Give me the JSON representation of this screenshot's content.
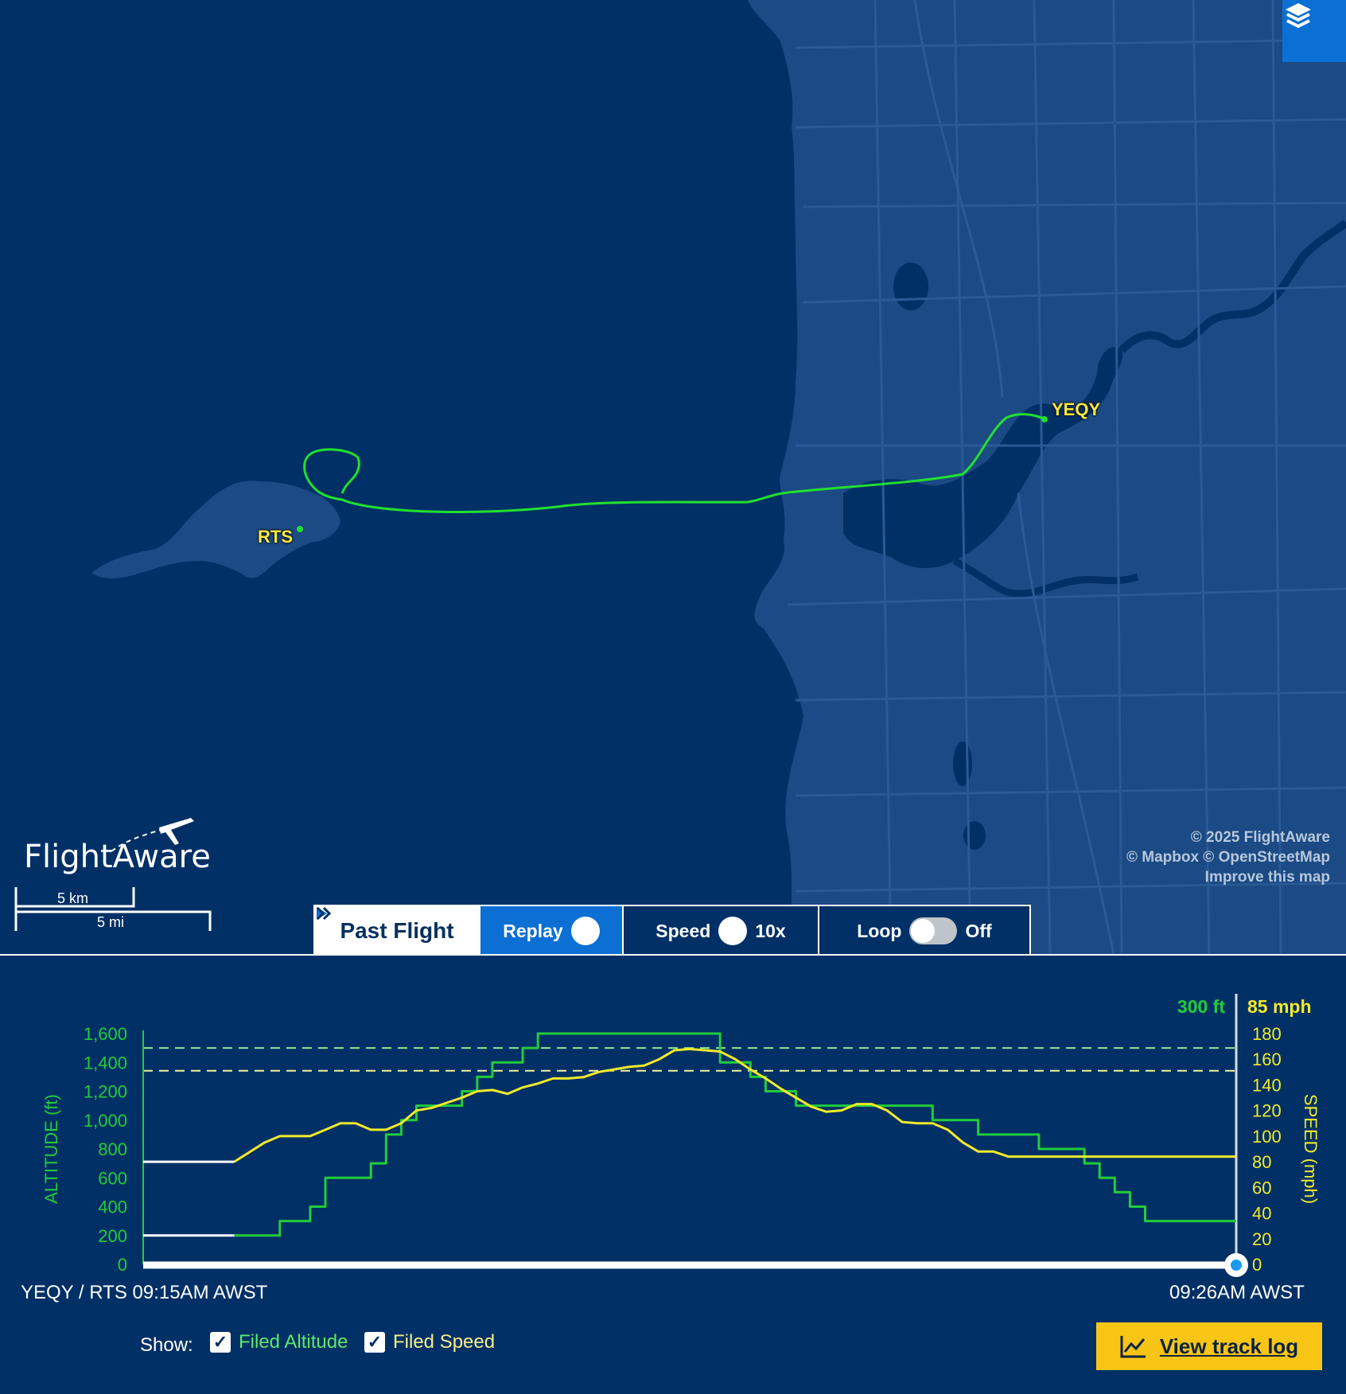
{
  "map": {
    "airports": [
      {
        "code": "YEQY"
      },
      {
        "code": "RTS"
      }
    ],
    "colors": {
      "ocean": "#003066",
      "land": "#1b4a85",
      "track": "#22e02e",
      "label": "#ffe93a"
    },
    "attribution": [
      "© 2025 FlightAware",
      "© Mapbox © OpenStreetMap",
      "Improve this map"
    ],
    "scale": {
      "km_label": "5 km",
      "mi_label": "5 mi"
    },
    "logo_text": "FlightAware",
    "layers_icon": "layers-icon"
  },
  "controls": {
    "past_flight": "Past Flight",
    "replay": "Replay",
    "speed_label": "Speed",
    "speed_value": "10x",
    "loop_label": "Loop",
    "loop_state": "Off"
  },
  "chart_data": {
    "type": "line",
    "x": [
      0,
      6,
      8,
      9,
      10,
      11,
      12,
      13,
      14,
      15,
      16,
      17,
      18,
      19,
      20,
      21,
      22,
      23,
      24,
      25,
      26,
      27,
      28,
      29,
      30,
      31,
      32,
      33,
      34,
      35,
      36,
      37,
      38,
      39,
      40,
      41,
      42,
      43,
      44,
      45,
      46,
      47,
      48,
      49,
      50,
      51,
      52,
      53,
      54,
      55,
      56,
      57,
      58,
      59,
      60,
      61,
      62,
      63,
      64,
      65,
      66,
      67,
      68,
      69,
      70,
      71,
      72
    ],
    "series": [
      {
        "name": "Filed Altitude",
        "axis": "left",
        "color": "#22cc3a",
        "values": [
          200,
          200,
          200,
          300,
          300,
          400,
          600,
          600,
          600,
          700,
          900,
          1000,
          1100,
          1100,
          1100,
          1200,
          1300,
          1400,
          1400,
          1500,
          1600,
          1600,
          1600,
          1600,
          1600,
          1600,
          1600,
          1600,
          1600,
          1600,
          1600,
          1600,
          1400,
          1400,
          1300,
          1200,
          1200,
          1100,
          1100,
          1100,
          1100,
          1100,
          1100,
          1100,
          1100,
          1100,
          1000,
          1000,
          1000,
          900,
          900,
          900,
          900,
          800,
          800,
          800,
          700,
          600,
          500,
          400,
          300,
          300,
          300,
          300,
          300,
          300,
          300
        ]
      },
      {
        "name": "Filed Speed",
        "axis": "right",
        "color": "#f2ea2a",
        "values": [
          80,
          80,
          95,
          100,
          100,
          100,
          105,
          110,
          110,
          105,
          105,
          110,
          120,
          122,
          126,
          130,
          135,
          136,
          133,
          138,
          141,
          145,
          145,
          146,
          150,
          152,
          154,
          155,
          160,
          167,
          168,
          167,
          166,
          160,
          152,
          145,
          137,
          130,
          123,
          119,
          120,
          125,
          125,
          120,
          111,
          110,
          110,
          105,
          95,
          88,
          88,
          84,
          84,
          84,
          84,
          84,
          84,
          84,
          84,
          84,
          84,
          84,
          84,
          84,
          84,
          84,
          84
        ]
      }
    ],
    "left_axis": {
      "label": "ALTITUDE (ft)",
      "ticks": [
        "0",
        "200",
        "400",
        "600",
        "800",
        "1,000",
        "1,200",
        "1,400",
        "1,600"
      ],
      "range": [
        0,
        1600
      ]
    },
    "right_axis": {
      "label": "SPEED (mph)",
      "ticks": [
        "0",
        "20",
        "40",
        "60",
        "80",
        "100",
        "120",
        "140",
        "160",
        "180"
      ],
      "range": [
        0,
        180
      ]
    },
    "current_altitude": "300 ft",
    "current_speed": "85 mph",
    "start_label": "YEQY / RTS 09:15AM AWST",
    "end_label": "09:26AM AWST",
    "filed_altitude_ref": 1500,
    "filed_speed_ref": 151
  },
  "legend": {
    "show_label": "Show:",
    "altitude_label": "Filed Altitude",
    "speed_label": "Filed Speed",
    "altitude_color": "#5ee86a",
    "speed_color": "#f6ef8a"
  },
  "track_log": {
    "label": "View track log",
    "icon": "chart-line-icon"
  }
}
